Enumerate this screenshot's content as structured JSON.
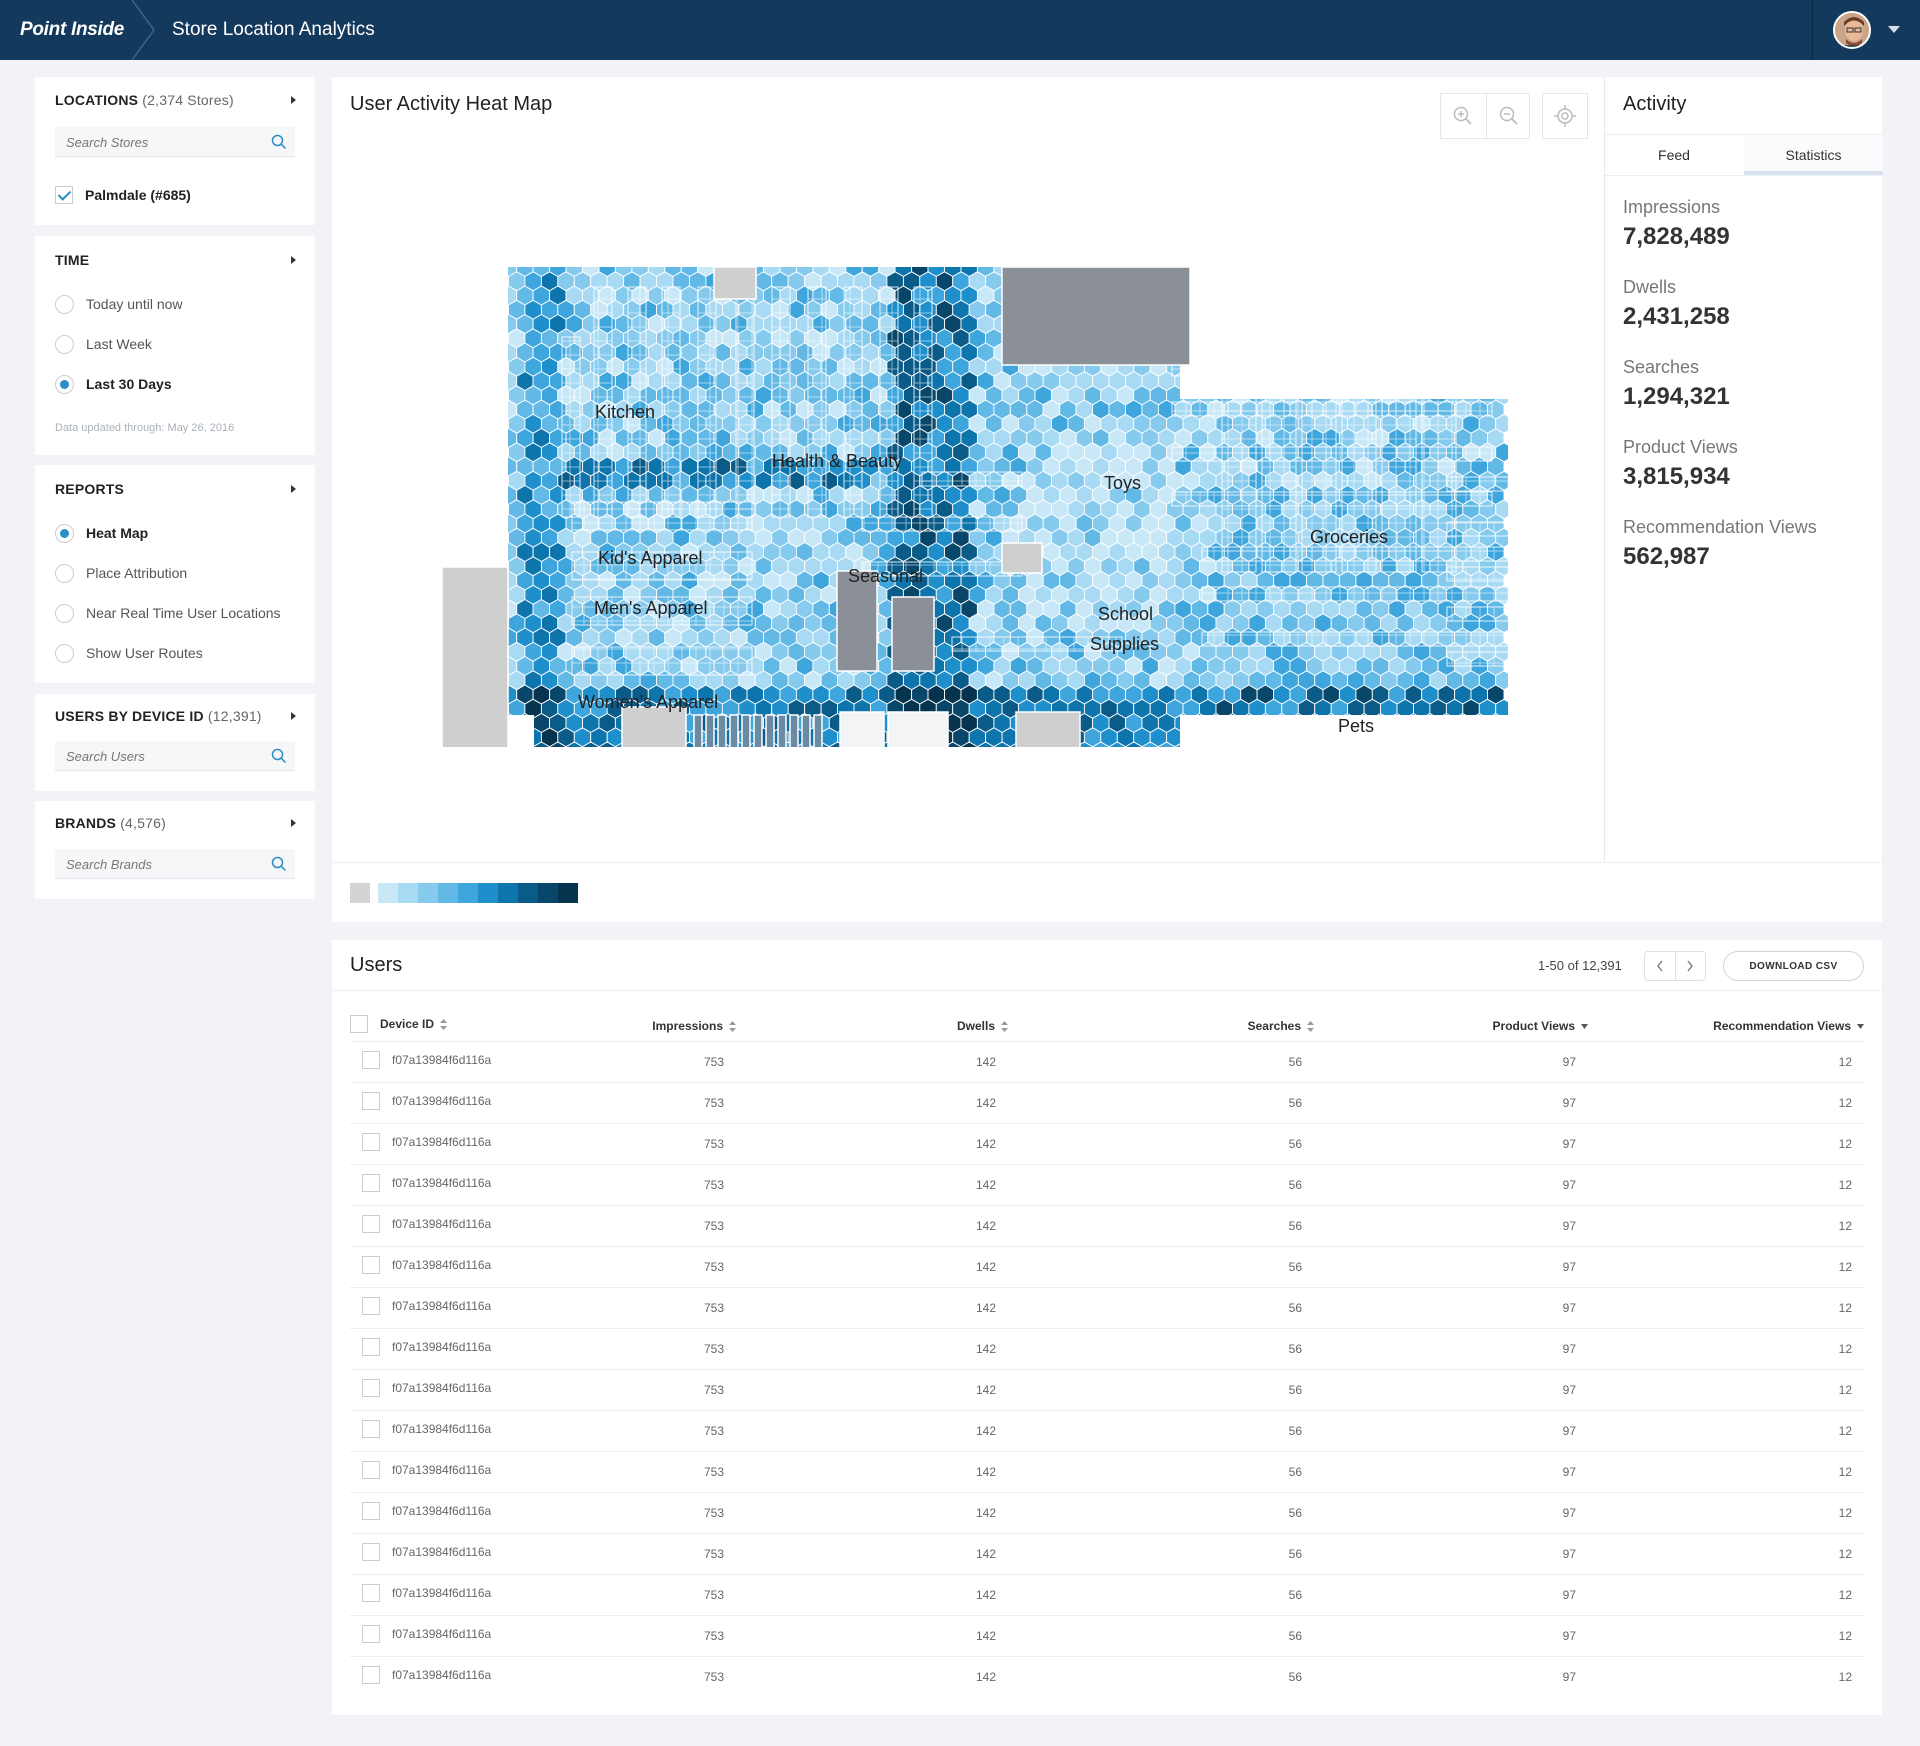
{
  "header": {
    "logo_text": "Point Inside",
    "app_title": "Store Location Analytics"
  },
  "locations": {
    "heading": "LOCATIONS",
    "count": "(2,374 Stores)",
    "search_placeholder": "Search Stores",
    "selected_store": "Palmdale (#685)"
  },
  "time": {
    "heading": "TIME",
    "options": [
      "Today until now",
      "Last Week",
      "Last 30 Days"
    ],
    "selected": "Last 30 Days",
    "note": "Data updated through: May 26, 2016"
  },
  "reports": {
    "heading": "REPORTS",
    "options": [
      "Heat Map",
      "Place Attribution",
      "Near Real Time User Locations",
      "Show User Routes"
    ],
    "selected": "Heat Map"
  },
  "users_by_device": {
    "heading": "USERS BY DEVICE ID",
    "count": "(12,391)",
    "search_placeholder": "Search Users"
  },
  "brands": {
    "heading": "BRANDS",
    "count": "(4,576)",
    "search_placeholder": "Search Brands"
  },
  "heatmap": {
    "title": "User Activity Heat Map",
    "tools": [
      "zoom-in-icon",
      "zoom-out-icon",
      "locate-icon"
    ],
    "departments": [
      "Kitchen",
      "Health & Beauty",
      "Toys",
      "Groceries",
      "Kid's Apparel",
      "Seasonal",
      "Men's Apparel",
      "School",
      "Supplies",
      "Pets",
      "Women's Apparel"
    ],
    "palette": [
      "#c8e8f8",
      "#a9daf3",
      "#86caed",
      "#63b9e5",
      "#3ea6dc",
      "#1f8fcb",
      "#0e74ac",
      "#0a5b88",
      "#084769",
      "#06344f"
    ],
    "legend_none": "#d3d3d3",
    "fixture_color": "#8a8f98",
    "blocked_color": "#cfcfcf"
  },
  "activity": {
    "title": "Activity",
    "tabs": [
      "Feed",
      "Statistics"
    ],
    "active_tab": "Statistics",
    "stats": [
      {
        "label": "Impressions",
        "value": "7,828,489"
      },
      {
        "label": "Dwells",
        "value": "2,431,258"
      },
      {
        "label": "Searches",
        "value": "1,294,321"
      },
      {
        "label": "Product Views",
        "value": "3,815,934"
      },
      {
        "label": "Recommendation Views",
        "value": "562,987"
      }
    ]
  },
  "users": {
    "title": "Users",
    "pagination": "1-50 of 12,391",
    "download_label": "DOWNLOAD CSV",
    "columns": [
      "Device ID",
      "Impressions",
      "Dwells",
      "Searches",
      "Product Views",
      "Recommendation Views"
    ],
    "rows": [
      [
        "f07a13984f6d116a",
        "753",
        "142",
        "56",
        "97",
        "12"
      ],
      [
        "f07a13984f6d116a",
        "753",
        "142",
        "56",
        "97",
        "12"
      ],
      [
        "f07a13984f6d116a",
        "753",
        "142",
        "56",
        "97",
        "12"
      ],
      [
        "f07a13984f6d116a",
        "753",
        "142",
        "56",
        "97",
        "12"
      ],
      [
        "f07a13984f6d116a",
        "753",
        "142",
        "56",
        "97",
        "12"
      ],
      [
        "f07a13984f6d116a",
        "753",
        "142",
        "56",
        "97",
        "12"
      ],
      [
        "f07a13984f6d116a",
        "753",
        "142",
        "56",
        "97",
        "12"
      ],
      [
        "f07a13984f6d116a",
        "753",
        "142",
        "56",
        "97",
        "12"
      ],
      [
        "f07a13984f6d116a",
        "753",
        "142",
        "56",
        "97",
        "12"
      ],
      [
        "f07a13984f6d116a",
        "753",
        "142",
        "56",
        "97",
        "12"
      ],
      [
        "f07a13984f6d116a",
        "753",
        "142",
        "56",
        "97",
        "12"
      ],
      [
        "f07a13984f6d116a",
        "753",
        "142",
        "56",
        "97",
        "12"
      ],
      [
        "f07a13984f6d116a",
        "753",
        "142",
        "56",
        "97",
        "12"
      ],
      [
        "f07a13984f6d116a",
        "753",
        "142",
        "56",
        "97",
        "12"
      ],
      [
        "f07a13984f6d116a",
        "753",
        "142",
        "56",
        "97",
        "12"
      ],
      [
        "f07a13984f6d116a",
        "753",
        "142",
        "56",
        "97",
        "12"
      ]
    ]
  }
}
